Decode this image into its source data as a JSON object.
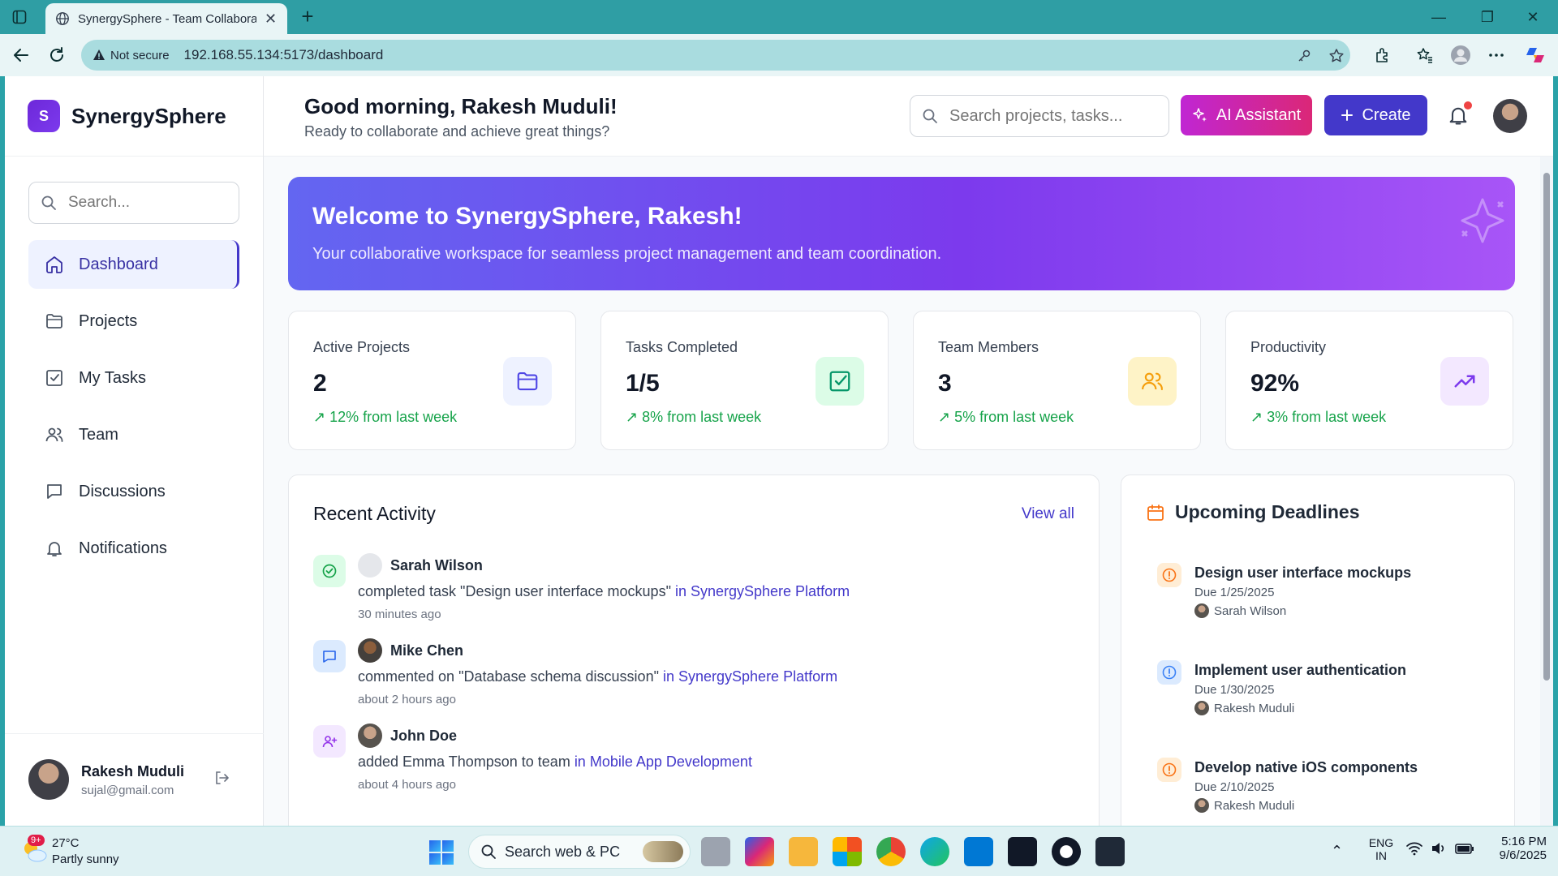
{
  "browser": {
    "tab_title": "SynergySphere - Team Collaborat",
    "security_label": "Not secure",
    "url": "192.168.55.134:5173/dashboard"
  },
  "brand": {
    "logo_letter": "S",
    "name": "SynergySphere"
  },
  "sidebar": {
    "search_placeholder": "Search...",
    "items": [
      {
        "label": "Dashboard",
        "icon": "home-icon",
        "active": true
      },
      {
        "label": "Projects",
        "icon": "folder-icon"
      },
      {
        "label": "My Tasks",
        "icon": "checkbox-icon"
      },
      {
        "label": "Team",
        "icon": "users-icon"
      },
      {
        "label": "Discussions",
        "icon": "message-icon"
      },
      {
        "label": "Notifications",
        "icon": "bell-icon"
      }
    ],
    "user": {
      "name": "Rakesh Muduli",
      "email": "sujal@gmail.com"
    }
  },
  "header": {
    "greeting": "Good morning, Rakesh Muduli!",
    "subtitle": "Ready to collaborate and achieve great things?",
    "search_placeholder": "Search projects, tasks...",
    "ai_button": "AI Assistant",
    "create_button": "Create"
  },
  "banner": {
    "title": "Welcome to SynergySphere, Rakesh!",
    "subtitle": "Your collaborative workspace for seamless project management and team coordination."
  },
  "stats": [
    {
      "label": "Active Projects",
      "value": "2",
      "trend": "↗ 12% from last week",
      "icon": "folder-icon",
      "color": "#4f46e5",
      "bg": "#eef2ff"
    },
    {
      "label": "Tasks Completed",
      "value": "1/5",
      "trend": "↗ 8% from last week",
      "icon": "check-square-icon",
      "color": "#059669",
      "bg": "#dcfce7"
    },
    {
      "label": "Team Members",
      "value": "3",
      "trend": "↗ 5% from last week",
      "icon": "users-icon",
      "color": "#f59e0b",
      "bg": "#fef3c7"
    },
    {
      "label": "Productivity",
      "value": "92%",
      "trend": "↗ 3% from last week",
      "icon": "trending-up-icon",
      "color": "#7c3aed",
      "bg": "#f3e8ff"
    }
  ],
  "activity": {
    "title": "Recent Activity",
    "view_all": "View all",
    "items": [
      {
        "name": "Sarah Wilson",
        "action": "completed task \"Design user interface mockups\" ",
        "link": "in SynergySphere Platform",
        "time": "30 minutes ago",
        "type_icon": "check-circle-icon"
      },
      {
        "name": "Mike Chen",
        "action": "commented on \"Database schema discussion\" ",
        "link": "in SynergySphere Platform",
        "time": "about 2 hours ago",
        "type_icon": "message-icon"
      },
      {
        "name": "John Doe",
        "action": "added Emma Thompson to team ",
        "link": "in Mobile App Development",
        "time": "about 4 hours ago",
        "type_icon": "user-plus-icon"
      }
    ]
  },
  "deadlines": {
    "title": "Upcoming Deadlines",
    "items": [
      {
        "task": "Design user interface mockups",
        "due": "Due 1/25/2025",
        "owner": "Sarah Wilson",
        "priority_color": "#f97316"
      },
      {
        "task": "Implement user authentication",
        "due": "Due 1/30/2025",
        "owner": "Rakesh Muduli",
        "priority_color": "#3b82f6"
      },
      {
        "task": "Develop native iOS components",
        "due": "Due 2/10/2025",
        "owner": "Rakesh Muduli",
        "priority_color": "#f97316"
      }
    ]
  },
  "taskbar": {
    "weather_badge": "9+",
    "temp": "27°C",
    "condition": "Partly sunny",
    "search": "Search web & PC",
    "lang_top": "ENG",
    "lang_bottom": "IN",
    "time": "5:16 PM",
    "date": "9/6/2025"
  }
}
